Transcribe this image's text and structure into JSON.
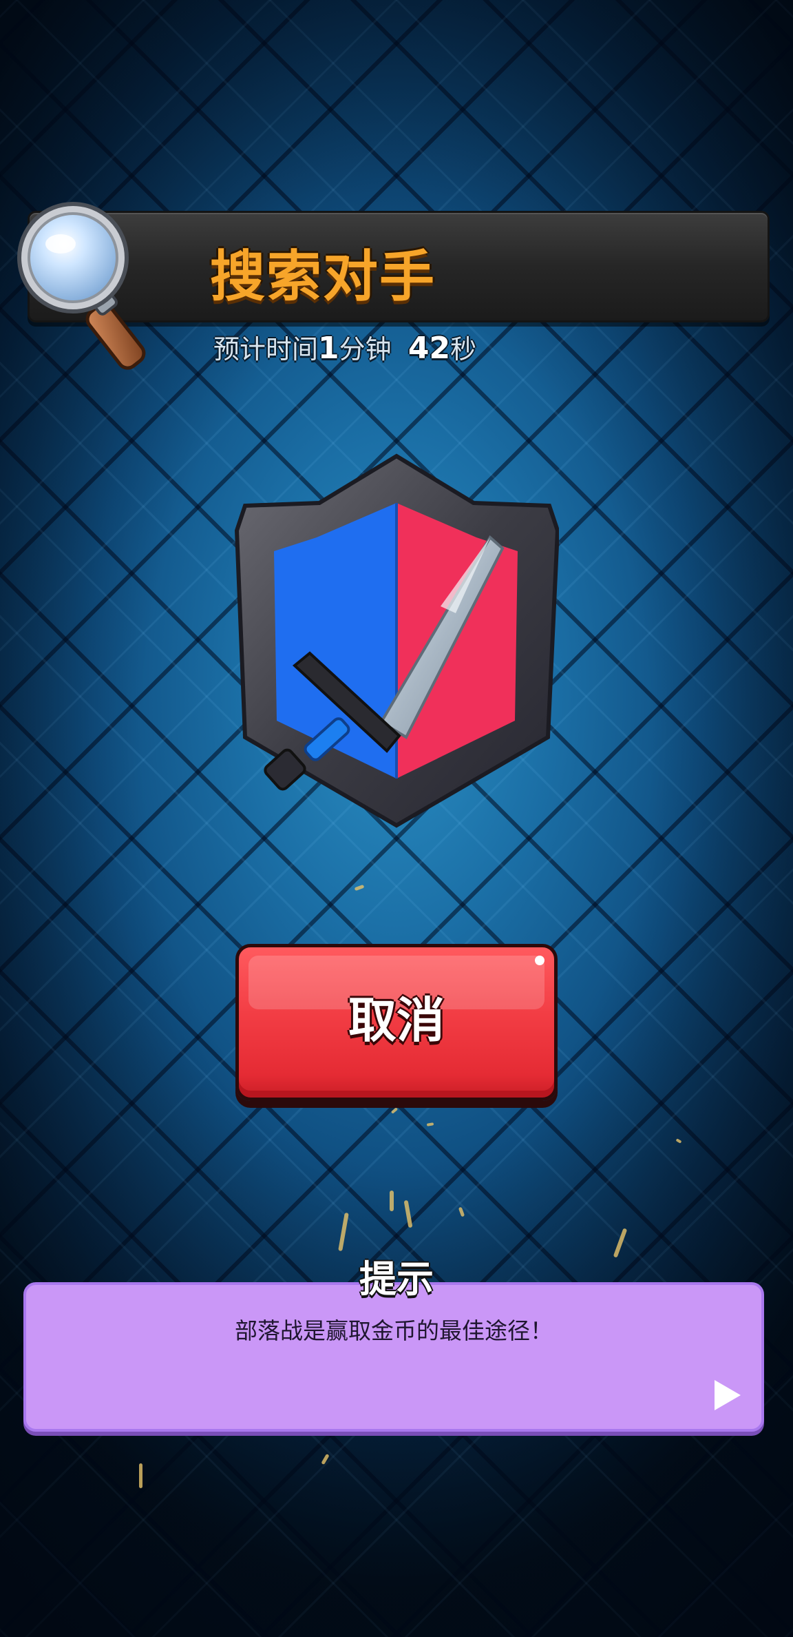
{
  "header": {
    "title": "搜索对手",
    "eta_prefix": "预计时间",
    "eta_minutes": "1",
    "eta_minutes_unit": "分钟",
    "eta_seconds": "42",
    "eta_seconds_unit": "秒"
  },
  "emblem": {
    "icon": "sword-shield-emblem-icon",
    "left_color": "#1f6ef0",
    "right_color": "#f0305a"
  },
  "cancel": {
    "label": "取消",
    "color": "#f23d44"
  },
  "tip": {
    "title": "提示",
    "text": "部落战是赢取金币的最佳途径！",
    "next_icon": "play-arrow-icon",
    "background": "#ca97f7"
  }
}
